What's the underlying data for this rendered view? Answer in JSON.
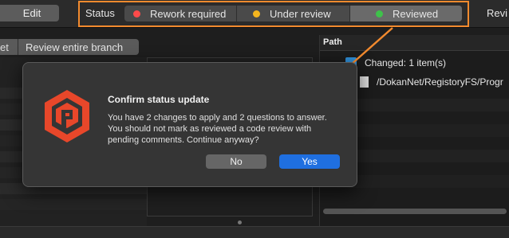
{
  "toolbar": {
    "edit_label": "Edit",
    "status_label": "Status",
    "status_options": [
      {
        "label": "Rework required",
        "dot_color": "#ff4a4a"
      },
      {
        "label": "Under review",
        "dot_color": "#f5b61e"
      },
      {
        "label": "Reviewed",
        "dot_color": "#3ec24a"
      }
    ],
    "selected_status": "Reviewed",
    "right_tab_label": "Revi",
    "highlight_color": "#f28a2e"
  },
  "left_tabs": {
    "partial_label": "et",
    "review_branch_label": "Review entire branch"
  },
  "right_panel": {
    "header": "Path",
    "changed_label": "Changed: 1 item(s)",
    "file_path": "/DokanNet/RegistoryFS/Progr"
  },
  "dialog": {
    "title": "Confirm status update",
    "message": "You have 2 changes to apply and 2 questions to answer. You should not mark as reviewed a code review with pending comments. Continue anyway?",
    "no_label": "No",
    "yes_label": "Yes",
    "logo_color": "#e8472a"
  }
}
